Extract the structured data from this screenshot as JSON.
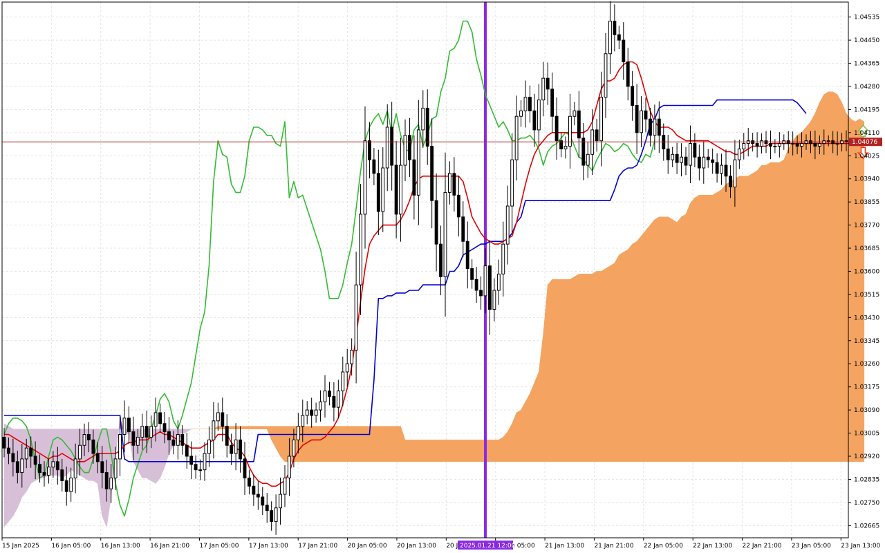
{
  "colors": {
    "background": "#ffffff",
    "grid": "#e4e4e4",
    "axis": "#000000",
    "bull_body": "#ffffff",
    "bear_body": "#000000",
    "wick": "#000000",
    "blue_candle": "#2e6db4",
    "tenkan": "#e00000",
    "kijun": "#0000d0",
    "chikou": "#33bb33",
    "cloud_bull": "#f4a460",
    "cloud_bear": "#d8bfd8",
    "bid_line": "#b22222",
    "bid_tag": "#b22222",
    "vline": "#8a2be2",
    "marker_bg": "#8a2be2",
    "arrow_up": "#7cc242",
    "arrow_down": "#ff3300"
  },
  "icons": {
    "buy_arrow": "arrow-up-icon",
    "sell_arrow": "arrow-down-icon"
  },
  "chart_data": {
    "type": "candlestick",
    "symbol_note": "",
    "ylim": [
      1.0262,
      1.0459
    ],
    "price_ticks": [
      "1.04535",
      "1.04450",
      "1.04365",
      "1.04280",
      "1.04195",
      "1.04110",
      "1.04025",
      "1.03940",
      "1.03855",
      "1.03770",
      "1.03685",
      "1.03600",
      "1.03515",
      "1.03430",
      "1.03345",
      "1.03260",
      "1.03175",
      "1.03090",
      "1.03005",
      "1.02920",
      "1.02835",
      "1.02750",
      "1.02665"
    ],
    "time_labels": [
      "15 Jan 2025",
      "16 Jan 05:00",
      "16 Jan 13:00",
      "16 Jan 21:00",
      "17 Jan 05:00",
      "17 Jan 13:00",
      "17 Jan 21:00",
      "20 Jan 05:00",
      "20 Jan 13:00",
      "20 Jan 21:00",
      "21 Jan 05:00",
      "21 Jan 13:00",
      "21 Jan 21:00",
      "22 Jan 05:00",
      "22 Jan 13:00",
      "22 Jan 21:00",
      "23 Jan 05:00",
      "23 Jan 13:00"
    ],
    "bars_total": 190,
    "current_price": "1.04076",
    "vline_bar": 108,
    "vline_label": "2025.01.21 12:00",
    "close": [
      1.0295,
      1.0293,
      1.029,
      1.0286,
      1.0291,
      1.0295,
      1.0292,
      1.0289,
      1.0286,
      1.0285,
      1.0288,
      1.029,
      1.0287,
      1.0283,
      1.0279,
      1.0284,
      1.0291,
      1.0296,
      1.03,
      1.0298,
      1.0293,
      1.029,
      1.0286,
      1.028,
      1.0284,
      1.0291,
      1.03,
      1.0306,
      1.0301,
      1.0296,
      1.0299,
      1.0303,
      1.0299,
      1.0303,
      1.0308,
      1.0304,
      1.0301,
      1.0298,
      1.0296,
      1.03,
      1.0296,
      1.0292,
      1.0289,
      1.0287,
      1.0287,
      1.0293,
      1.0298,
      1.0305,
      1.0308,
      1.0303,
      1.0296,
      1.0293,
      1.0298,
      1.0291,
      1.0284,
      1.0281,
      1.0278,
      1.0277,
      1.0274,
      1.0272,
      1.0268,
      1.0273,
      1.0278,
      1.0284,
      1.0292,
      1.0298,
      1.0303,
      1.0307,
      1.0309,
      1.0307,
      1.0309,
      1.0312,
      1.0316,
      1.0314,
      1.031,
      1.0316,
      1.0323,
      1.0326,
      1.0331,
      1.0355,
      1.0381,
      1.0408,
      1.0401,
      1.0396,
      1.0382,
      1.0398,
      1.0413,
      1.0399,
      1.0381,
      1.0399,
      1.041,
      1.0401,
      1.0388,
      1.0412,
      1.042,
      1.0406,
      1.0386,
      1.037,
      1.0358,
      1.0389,
      1.0396,
      1.0388,
      1.038,
      1.0371,
      1.0361,
      1.0357,
      1.0353,
      1.0351,
      1.0362,
      1.0346,
      1.0353,
      1.0359,
      1.037,
      1.0384,
      1.0401,
      1.0417,
      1.0419,
      1.0424,
      1.0419,
      1.0412,
      1.0423,
      1.0431,
      1.0427,
      1.0417,
      1.0408,
      1.0405,
      1.0406,
      1.0417,
      1.0419,
      1.0409,
      1.0399,
      1.0403,
      1.0412,
      1.0408,
      1.0424,
      1.044,
      1.0452,
      1.0447,
      1.0445,
      1.0437,
      1.0428,
      1.0421,
      1.0411,
      1.0419,
      1.0416,
      1.041,
      1.0416,
      1.041,
      1.0405,
      1.0401,
      1.0403,
      1.04,
      1.0402,
      1.0399,
      1.0407,
      1.0402,
      1.0398,
      1.0402,
      1.0401,
      1.04,
      1.0396,
      1.0399,
      1.0395,
      1.0391,
      1.0401,
      1.0405,
      1.0407,
      1.0408,
      1.0407,
      1.0406,
      1.0408,
      1.0407,
      1.0406,
      1.0406,
      1.0407,
      1.0408,
      1.0407,
      1.0407,
      1.0406,
      1.0407,
      1.0408,
      1.0407,
      1.0406,
      1.0407,
      1.0408,
      1.0408,
      1.0407,
      1.0407,
      1.0408,
      1.0408
    ],
    "tenkan": [
      1.03,
      1.03,
      1.0299,
      1.0298,
      1.0297,
      1.0296,
      1.0295,
      1.0294,
      1.0293,
      1.0292,
      1.0291,
      1.0292,
      1.0292,
      1.0293,
      1.0292,
      1.0291,
      1.029,
      1.029,
      1.029,
      1.0291,
      1.0292,
      1.0293,
      1.0293,
      1.0293,
      1.0293,
      1.0293,
      1.0294,
      1.0296,
      1.0297,
      1.0297,
      1.0298,
      1.0298,
      1.0298,
      1.0299,
      1.03,
      1.0301,
      1.03,
      1.03,
      1.0299,
      1.0298,
      1.0297,
      1.0296,
      1.0295,
      1.0295,
      1.0295,
      1.0296,
      1.0297,
      1.0298,
      1.03,
      1.03,
      1.03,
      1.0297,
      1.0295,
      1.0294,
      1.0292,
      1.0288,
      1.0285,
      1.0283,
      1.0282,
      1.0282,
      1.0281,
      1.0281,
      1.0282,
      1.0283,
      1.0286,
      1.0291,
      1.0294,
      1.0296,
      1.0297,
      1.0298,
      1.0298,
      1.0298,
      1.0299,
      1.0301,
      1.0303,
      1.0306,
      1.0311,
      1.0317,
      1.0325,
      1.0336,
      1.0349,
      1.0361,
      1.037,
      1.0373,
      1.0375,
      1.0377,
      1.0377,
      1.0377,
      1.0377,
      1.0379,
      1.0382,
      1.0386,
      1.0391,
      1.0394,
      1.0395,
      1.0395,
      1.0395,
      1.0395,
      1.0395,
      1.0395,
      1.0395,
      1.0395,
      1.0395,
      1.0393,
      1.0387,
      1.038,
      1.0377,
      1.0374,
      1.0372,
      1.0371,
      1.037,
      1.037,
      1.0371,
      1.0372,
      1.0373,
      1.0378,
      1.0385,
      1.0392,
      1.0398,
      1.0403,
      1.0406,
      1.0408,
      1.041,
      1.0411,
      1.0411,
      1.0411,
      1.0411,
      1.0411,
      1.0411,
      1.0411,
      1.0411,
      1.0412,
      1.0415,
      1.0421,
      1.0427,
      1.043,
      1.043,
      1.0431,
      1.0434,
      1.0436,
      1.0437,
      1.0437,
      1.0436,
      1.0431,
      1.0425,
      1.0419,
      1.0415,
      1.0413,
      1.0413,
      1.0413,
      1.0412,
      1.041,
      1.0409,
      1.0408,
      1.0408,
      1.0408,
      1.0408,
      1.0408,
      1.0408,
      1.0407,
      1.0406,
      1.0405,
      1.0404,
      1.0404,
      1.0403,
      1.0403,
      1.0404,
      1.0405,
      1.0406,
      1.0406,
      1.0406,
      1.0406,
      1.0407,
      1.0407,
      1.0407,
      1.0407,
      1.0407,
      1.0407,
      1.0407,
      1.0407,
      1.0407,
      1.0407,
      1.0407,
      1.0407,
      1.0407,
      1.0407,
      1.0407,
      1.0407,
      1.0407,
      1.0407,
      1.0407,
      1.0407,
      1.0407
    ],
    "kijun": [
      1.0307,
      1.0307,
      1.0307,
      1.0307,
      1.0307,
      1.0307,
      1.0307,
      1.0307,
      1.0307,
      1.0307,
      1.0307,
      1.0307,
      1.0307,
      1.0307,
      1.0307,
      1.0307,
      1.0307,
      1.0307,
      1.0307,
      1.0307,
      1.0307,
      1.0307,
      1.0307,
      1.0307,
      1.0307,
      1.0307,
      1.0307,
      1.0291,
      1.029,
      1.029,
      1.029,
      1.029,
      1.029,
      1.029,
      1.029,
      1.029,
      1.029,
      1.029,
      1.029,
      1.029,
      1.029,
      1.029,
      1.029,
      1.029,
      1.029,
      1.029,
      1.029,
      1.029,
      1.029,
      1.029,
      1.029,
      1.029,
      1.029,
      1.029,
      1.029,
      1.029,
      1.029,
      1.03,
      1.03,
      1.03,
      1.03,
      1.03,
      1.03,
      1.03,
      1.03,
      1.03,
      1.03,
      1.03,
      1.03,
      1.03,
      1.03,
      1.03,
      1.03,
      1.03,
      1.03,
      1.03,
      1.03,
      1.03,
      1.03,
      1.03,
      1.03,
      1.03,
      1.03,
      1.032,
      1.035,
      1.035,
      1.0351,
      1.0351,
      1.0352,
      1.0352,
      1.0352,
      1.0353,
      1.0353,
      1.0353,
      1.0355,
      1.0355,
      1.0355,
      1.0355,
      1.0355,
      1.0355,
      1.036,
      1.036,
      1.0362,
      1.0366,
      1.0367,
      1.0368,
      1.0369,
      1.037,
      1.037,
      1.0371,
      1.0371,
      1.0371,
      1.0371,
      1.0372,
      1.0374,
      1.0378,
      1.038,
      1.0386,
      1.0386,
      1.0386,
      1.0386,
      1.0386,
      1.0386,
      1.0386,
      1.0386,
      1.0386,
      1.0386,
      1.0386,
      1.0386,
      1.0386,
      1.0386,
      1.0386,
      1.0386,
      1.0386,
      1.0386,
      1.0386,
      1.0386,
      1.039,
      1.0395,
      1.0397,
      1.0398,
      1.0398,
      1.0399,
      1.0403,
      1.0408,
      1.0414,
      1.0416,
      1.042,
      1.0421,
      1.0421,
      1.0421,
      1.0421,
      1.0421,
      1.0421,
      1.0421,
      1.0421,
      1.0421,
      1.0421,
      1.0421,
      1.0421,
      1.0423,
      1.0423,
      1.0423,
      1.0423,
      1.0423,
      1.0423,
      1.0423,
      1.0423,
      1.0423,
      1.0423,
      1.0423,
      1.0423,
      1.0423,
      1.0423,
      1.0423,
      1.0423,
      1.0423,
      1.0423,
      1.0422,
      1.042,
      1.0418,
      null,
      null,
      null,
      null,
      null,
      null,
      null,
      null,
      null,
      null,
      null,
      null
    ],
    "chikou": [
      1.03,
      1.0304,
      1.0306,
      1.0306,
      1.0305,
      1.0303,
      1.0298,
      1.029,
      1.0284,
      1.0285,
      1.0292,
      1.0298,
      1.0299,
      1.0298,
      1.0296,
      1.0294,
      1.0291,
      1.0288,
      1.0286,
      1.0286,
      1.0291,
      1.0297,
      1.0302,
      1.0302,
      1.0293,
      1.0282,
      1.0274,
      1.027,
      1.0276,
      1.0284,
      1.0289,
      1.0294,
      1.0296,
      1.0302,
      1.0307,
      1.0313,
      1.0315,
      1.0312,
      1.0305,
      1.0302,
      1.0307,
      1.0313,
      1.0319,
      1.0329,
      1.0339,
      1.0345,
      1.0362,
      1.0393,
      1.0408,
      1.0403,
      1.0402,
      1.0392,
      1.0389,
      1.0389,
      1.0395,
      1.0408,
      1.0413,
      1.0413,
      1.0412,
      1.041,
      1.041,
      1.0407,
      1.0406,
      1.0415,
      1.0387,
      1.0393,
      1.0387,
      1.0388,
      1.0383,
      1.0378,
      1.0373,
      1.0368,
      1.036,
      1.035,
      1.035,
      1.035,
      1.0355,
      1.0363,
      1.037,
      1.0383,
      1.0397,
      1.0408,
      1.0413,
      1.0416,
      1.0418,
      1.0414,
      1.0419,
      1.0411,
      1.0418,
      1.041,
      1.0405,
      1.0404,
      1.0412,
      1.0414,
      1.0406,
      1.041,
      1.0416,
      1.0417,
      1.0426,
      1.0431,
      1.0441,
      1.0442,
      1.0445,
      1.0452,
      1.0452,
      1.0448,
      1.0438,
      1.0432,
      1.0425,
      1.0421,
      1.0417,
      1.0413,
      1.0415,
      1.0412,
      1.0408,
      1.0408,
      1.0409,
      1.0409,
      1.041,
      1.0408,
      1.0405,
      1.0399,
      1.0404,
      1.0406,
      1.0407,
      1.0409,
      1.0411,
      1.041,
      1.0406,
      1.0402,
      1.0401,
      1.0399,
      1.0397,
      1.0401,
      1.0404,
      1.0407,
      1.0406,
      1.0404,
      1.0405,
      1.0407,
      1.0406,
      1.0403,
      1.0401,
      1.04,
      1.0403,
      1.0402,
      1.0408,
      null,
      null,
      null,
      null,
      null,
      null,
      null,
      null,
      null,
      null,
      null,
      null,
      null,
      null,
      null,
      null,
      null,
      null,
      null,
      null,
      null,
      null,
      null,
      null,
      null,
      null,
      null,
      null,
      null,
      null,
      null,
      null,
      null,
      null,
      null,
      null,
      null,
      null,
      null,
      null,
      null,
      null,
      null,
      null,
      null,
      null,
      null,
      null
    ],
    "senkou_a": [
      1.0266,
      1.0268,
      1.027,
      1.0273,
      1.0277,
      1.0279,
      1.0282,
      1.0283,
      1.0284,
      1.0284,
      1.0285,
      1.0285,
      1.0285,
      1.0284,
      1.0285,
      1.0287,
      1.0286,
      1.0285,
      1.0284,
      1.0283,
      1.0283,
      1.0282,
      1.027,
      1.0266,
      1.0277,
      1.0292,
      1.0306,
      1.0301,
      1.03,
      1.029,
      1.0287,
      1.0284,
      1.0284,
      1.0283,
      1.0282,
      1.0284,
      1.0288,
      1.0293,
      1.0296,
      1.0298,
      1.03,
      1.0301,
      1.0302,
      1.0302,
      1.0302,
      1.0302,
      1.0302,
      1.0302,
      1.0303,
      1.0303,
      1.0303,
      1.0303,
      1.0303,
      1.0303,
      1.0303,
      1.0303,
      1.0303,
      1.0303,
      1.0303,
      1.0303,
      1.0303,
      1.0303,
      1.0303,
      1.0303,
      1.0303,
      1.0303,
      1.0303,
      1.0303,
      1.0303,
      1.0303,
      1.0303,
      1.0303,
      1.0303,
      1.0303,
      1.0303,
      1.0303,
      1.0303,
      1.0303,
      1.0303,
      1.0303,
      1.0303,
      1.0303,
      1.0303,
      1.0303,
      1.0303,
      1.0303,
      1.0303,
      1.0303,
      1.0303,
      1.0303,
      1.0298,
      1.0298,
      1.0298,
      1.0298,
      1.0298,
      1.0298,
      1.0298,
      1.0298,
      1.0298,
      1.0298,
      1.0298,
      1.0298,
      1.0298,
      1.0298,
      1.0298,
      1.0298,
      1.0298,
      1.0298,
      1.0298,
      1.0298,
      1.0298,
      1.0298,
      1.0299,
      1.0301,
      1.0304,
      1.0308,
      1.0309,
      1.0312,
      1.0315,
      1.0319,
      1.0323,
      1.0337,
      1.0355,
      1.0357,
      1.0357,
      1.0357,
      1.0357,
      1.0357,
      1.0358,
      1.0359,
      1.0359,
      1.0359,
      1.0359,
      1.036,
      1.036,
      1.0361,
      1.0362,
      1.0363,
      1.0366,
      1.0367,
      1.0368,
      1.037,
      1.0371,
      1.0373,
      1.0375,
      1.0377,
      1.0379,
      1.038,
      1.038,
      1.038,
      1.0379,
      1.0378,
      1.038,
      1.0381,
      1.0385,
      1.0387,
      1.0388,
      1.0388,
      1.0388,
      1.0388,
      1.0389,
      1.039,
      1.0392,
      1.0393,
      1.0394,
      1.0395,
      1.0395,
      1.0395,
      1.0396,
      1.0397,
      1.0399,
      1.0399,
      1.04,
      1.04,
      1.04,
      1.0401,
      1.0405,
      1.0408,
      1.041,
      1.0411,
      1.0413,
      1.0415,
      1.0418,
      1.0422,
      1.0425,
      1.0426,
      1.0426,
      1.0425,
      1.0422,
      1.0418,
      1.0416,
      1.0415,
      1.0416,
      1.0415
    ],
    "senkou_b": [
      1.0304,
      1.0303,
      1.0302,
      1.0302,
      1.0302,
      1.0302,
      1.0302,
      1.0302,
      1.0302,
      1.0302,
      1.0302,
      1.0302,
      1.0302,
      1.0302,
      1.0302,
      1.0302,
      1.0302,
      1.0302,
      1.0302,
      1.0302,
      1.0302,
      1.0302,
      1.0302,
      1.0302,
      1.0302,
      1.0302,
      1.0302,
      1.0302,
      1.0302,
      1.0302,
      1.0302,
      1.0302,
      1.0302,
      1.0302,
      1.0302,
      1.0302,
      1.0302,
      1.0302,
      1.0302,
      1.0302,
      1.0302,
      1.0302,
      1.0302,
      1.0302,
      1.0302,
      1.0302,
      1.0302,
      1.0302,
      1.0302,
      1.0302,
      1.0302,
      1.0302,
      1.0302,
      1.0302,
      1.0302,
      1.0302,
      1.0302,
      1.0302,
      1.0302,
      1.0302,
      1.0298,
      1.0295,
      1.0292,
      1.029,
      1.029,
      1.029,
      1.029,
      1.029,
      1.029,
      1.029,
      1.029,
      1.029,
      1.029,
      1.029,
      1.029,
      1.029,
      1.029,
      1.029,
      1.029,
      1.029,
      1.029,
      1.029,
      1.029,
      1.029,
      1.029,
      1.029,
      1.029,
      1.029,
      1.029,
      1.029,
      1.029,
      1.029,
      1.029,
      1.029,
      1.029,
      1.029,
      1.029,
      1.029,
      1.029,
      1.029,
      1.029,
      1.029,
      1.029,
      1.029,
      1.029,
      1.029,
      1.029,
      1.029,
      1.029,
      1.029,
      1.029,
      1.029,
      1.029,
      1.029,
      1.029,
      1.029,
      1.029,
      1.029,
      1.029,
      1.029,
      1.029,
      1.029,
      1.029,
      1.029,
      1.029,
      1.029,
      1.029,
      1.029,
      1.029,
      1.029,
      1.029,
      1.029,
      1.029,
      1.029,
      1.029,
      1.029,
      1.029,
      1.029,
      1.029,
      1.029,
      1.029,
      1.029,
      1.029,
      1.029,
      1.029,
      1.029,
      1.029,
      1.029,
      1.029,
      1.029,
      1.029,
      1.029,
      1.029,
      1.029,
      1.029,
      1.029,
      1.029,
      1.029,
      1.029,
      1.029,
      1.029,
      1.029,
      1.029,
      1.029,
      1.029,
      1.029,
      1.029,
      1.029,
      1.029,
      1.029,
      1.029,
      1.029,
      1.029,
      1.029,
      1.029,
      1.029,
      1.029,
      1.029,
      1.029,
      1.029,
      1.029,
      1.029,
      1.029,
      1.029,
      1.029,
      1.029,
      1.029,
      1.029,
      1.029,
      1.029,
      1.029,
      1.029,
      1.029,
      1.029
    ]
  }
}
